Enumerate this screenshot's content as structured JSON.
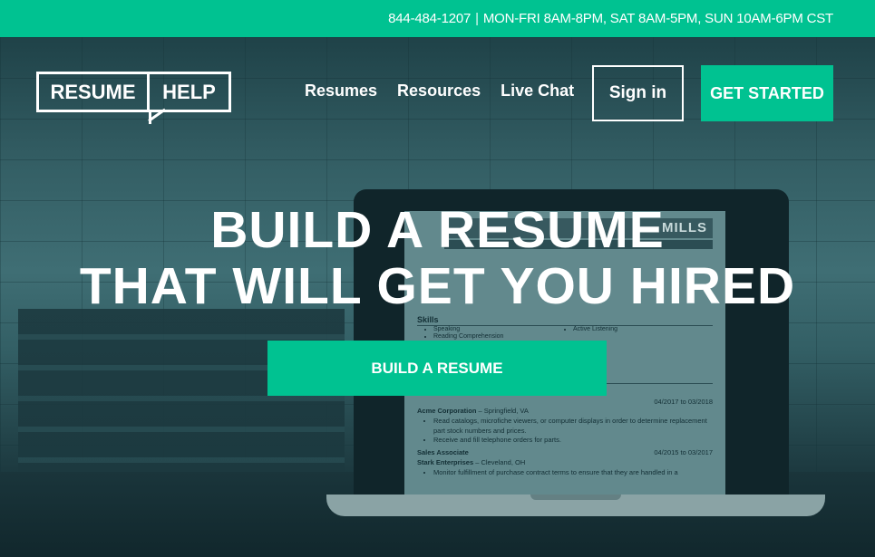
{
  "topbar": {
    "phone": "844-484-1207",
    "separator": "|",
    "hours": "MON-FRI 8AM-8PM, SAT 8AM-5PM, SUN 10AM-6PM CST"
  },
  "logo": {
    "part1": "RESUME",
    "part2": "HELP"
  },
  "nav": {
    "items": [
      {
        "label": "Resumes"
      },
      {
        "label": "Resources"
      },
      {
        "label": "Live Chat"
      }
    ],
    "signin": "Sign in",
    "get_started": "GET STARTED"
  },
  "hero": {
    "line1": "BUILD A RESUME",
    "line2": "THAT WILL GET YOU HIRED",
    "cta": "BUILD A RESUME"
  },
  "resume": {
    "name": "MILLS",
    "skills_heading": "Skills",
    "skills": [
      "Speaking",
      "Active Listening",
      "Reading Comprehension"
    ],
    "jobs": [
      {
        "company": "Acme Corporation",
        "location": " – Springfield, VA",
        "dates": "04/2017 to 03/2018",
        "bullets": [
          "Read catalogs, microfiche viewers, or computer displays in order to determine replacement part stock numbers and prices.",
          "Receive and fill telephone orders for parts."
        ]
      },
      {
        "title": "Sales Associate",
        "company": "Stark Enterprises",
        "location": " – Cleveland, OH",
        "dates": "04/2015 to 03/2017",
        "bullets": [
          "Monitor fulfillment of purchase contract terms to ensure that they are handled in a"
        ]
      }
    ]
  },
  "colors": {
    "accent": "#00c291",
    "hero_tint": "#2c555b"
  }
}
